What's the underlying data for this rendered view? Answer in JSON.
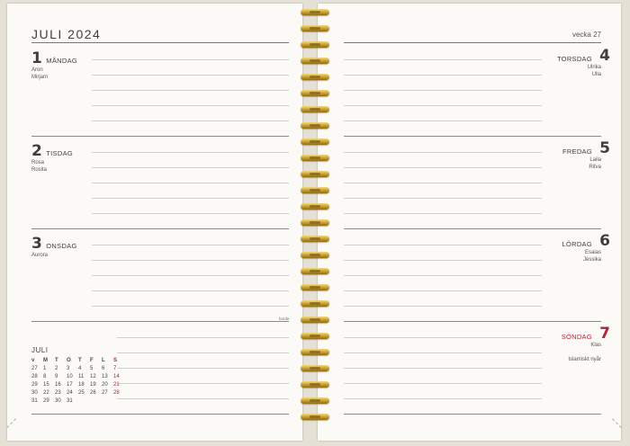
{
  "left": {
    "month_title": "JULI 2024",
    "days": [
      {
        "num": "1",
        "name": "MÅNDAG",
        "names": [
          "Aron",
          "Mirjam"
        ]
      },
      {
        "num": "2",
        "name": "TISDAG",
        "names": [
          "Rosa",
          "Rosita"
        ]
      },
      {
        "num": "3",
        "name": "ONSDAG",
        "names": [
          "Aurora"
        ]
      }
    ],
    "footer_small": "borde",
    "mini_cal": {
      "title": "JULI",
      "headers": [
        "v",
        "M",
        "T",
        "O",
        "T",
        "F",
        "L",
        "S"
      ],
      "rows": [
        [
          "27",
          "1",
          "2",
          "3",
          "4",
          "5",
          "6",
          "7"
        ],
        [
          "28",
          "8",
          "9",
          "10",
          "11",
          "12",
          "13",
          "14"
        ],
        [
          "29",
          "15",
          "16",
          "17",
          "18",
          "19",
          "20",
          "21"
        ],
        [
          "30",
          "22",
          "23",
          "24",
          "25",
          "26",
          "27",
          "28"
        ],
        [
          "31",
          "29",
          "30",
          "31",
          "",
          "",
          "",
          ""
        ]
      ]
    }
  },
  "right": {
    "week_title": "vecka 27",
    "days": [
      {
        "num": "4",
        "name": "TORSDAG",
        "names": [
          "Ulrika",
          "Ulla"
        ]
      },
      {
        "num": "5",
        "name": "FREDAG",
        "names": [
          "Laila",
          "Ritva"
        ]
      },
      {
        "num": "6",
        "name": "LÖRDAG",
        "names": [
          "Esaias",
          "Jessika"
        ]
      },
      {
        "num": "7",
        "name": "SÖNDAG",
        "names": [
          "Klas"
        ],
        "note": "Islamiskt nyår"
      }
    ]
  },
  "colors": {
    "sunday_red": "#b5213b",
    "spiral_gold": "#c89b2b"
  }
}
